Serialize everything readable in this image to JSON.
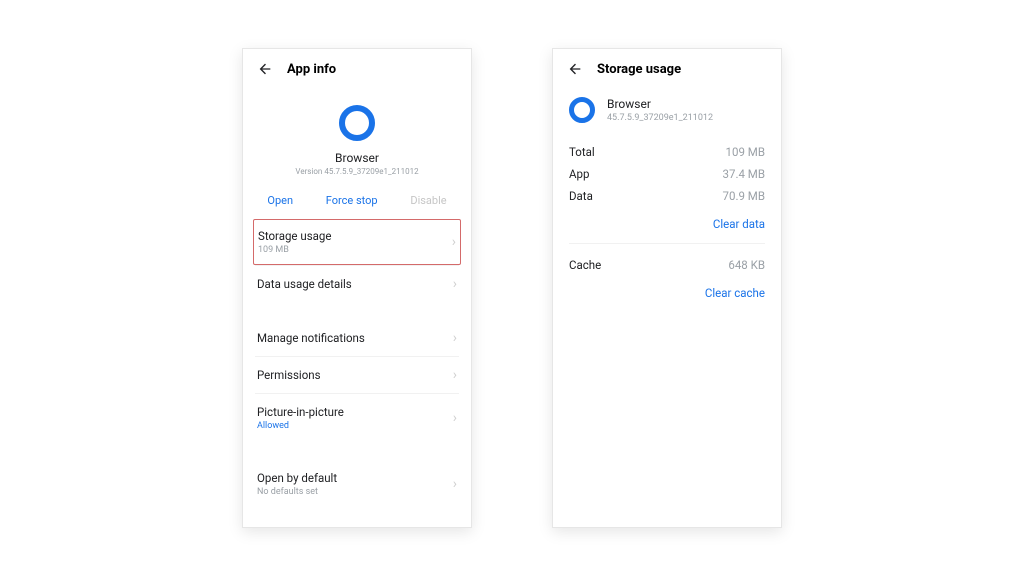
{
  "left": {
    "title": "App info",
    "app_name": "Browser",
    "version_line": "Version 45.7.5.9_37209e1_211012",
    "actions": {
      "open": "Open",
      "forcestop": "Force stop",
      "disable": "Disable"
    },
    "rows": {
      "storage": {
        "title": "Storage usage",
        "sub": "109 MB"
      },
      "datausage": {
        "title": "Data usage details",
        "sub": ""
      },
      "notifications": {
        "title": "Manage notifications",
        "sub": ""
      },
      "permissions": {
        "title": "Permissions",
        "sub": ""
      },
      "pip": {
        "title": "Picture-in-picture",
        "sub": "Allowed"
      },
      "openbydefault": {
        "title": "Open by default",
        "sub": "No defaults set"
      }
    }
  },
  "right": {
    "title": "Storage usage",
    "app_name": "Browser",
    "version_line": "45.7.5.9_37209e1_211012",
    "rows": {
      "total": {
        "k": "Total",
        "v": "109 MB"
      },
      "app": {
        "k": "App",
        "v": "37.4 MB"
      },
      "data": {
        "k": "Data",
        "v": "70.9 MB"
      },
      "cache": {
        "k": "Cache",
        "v": "648 KB"
      }
    },
    "links": {
      "clear_data": "Clear data",
      "clear_cache": "Clear cache"
    }
  }
}
